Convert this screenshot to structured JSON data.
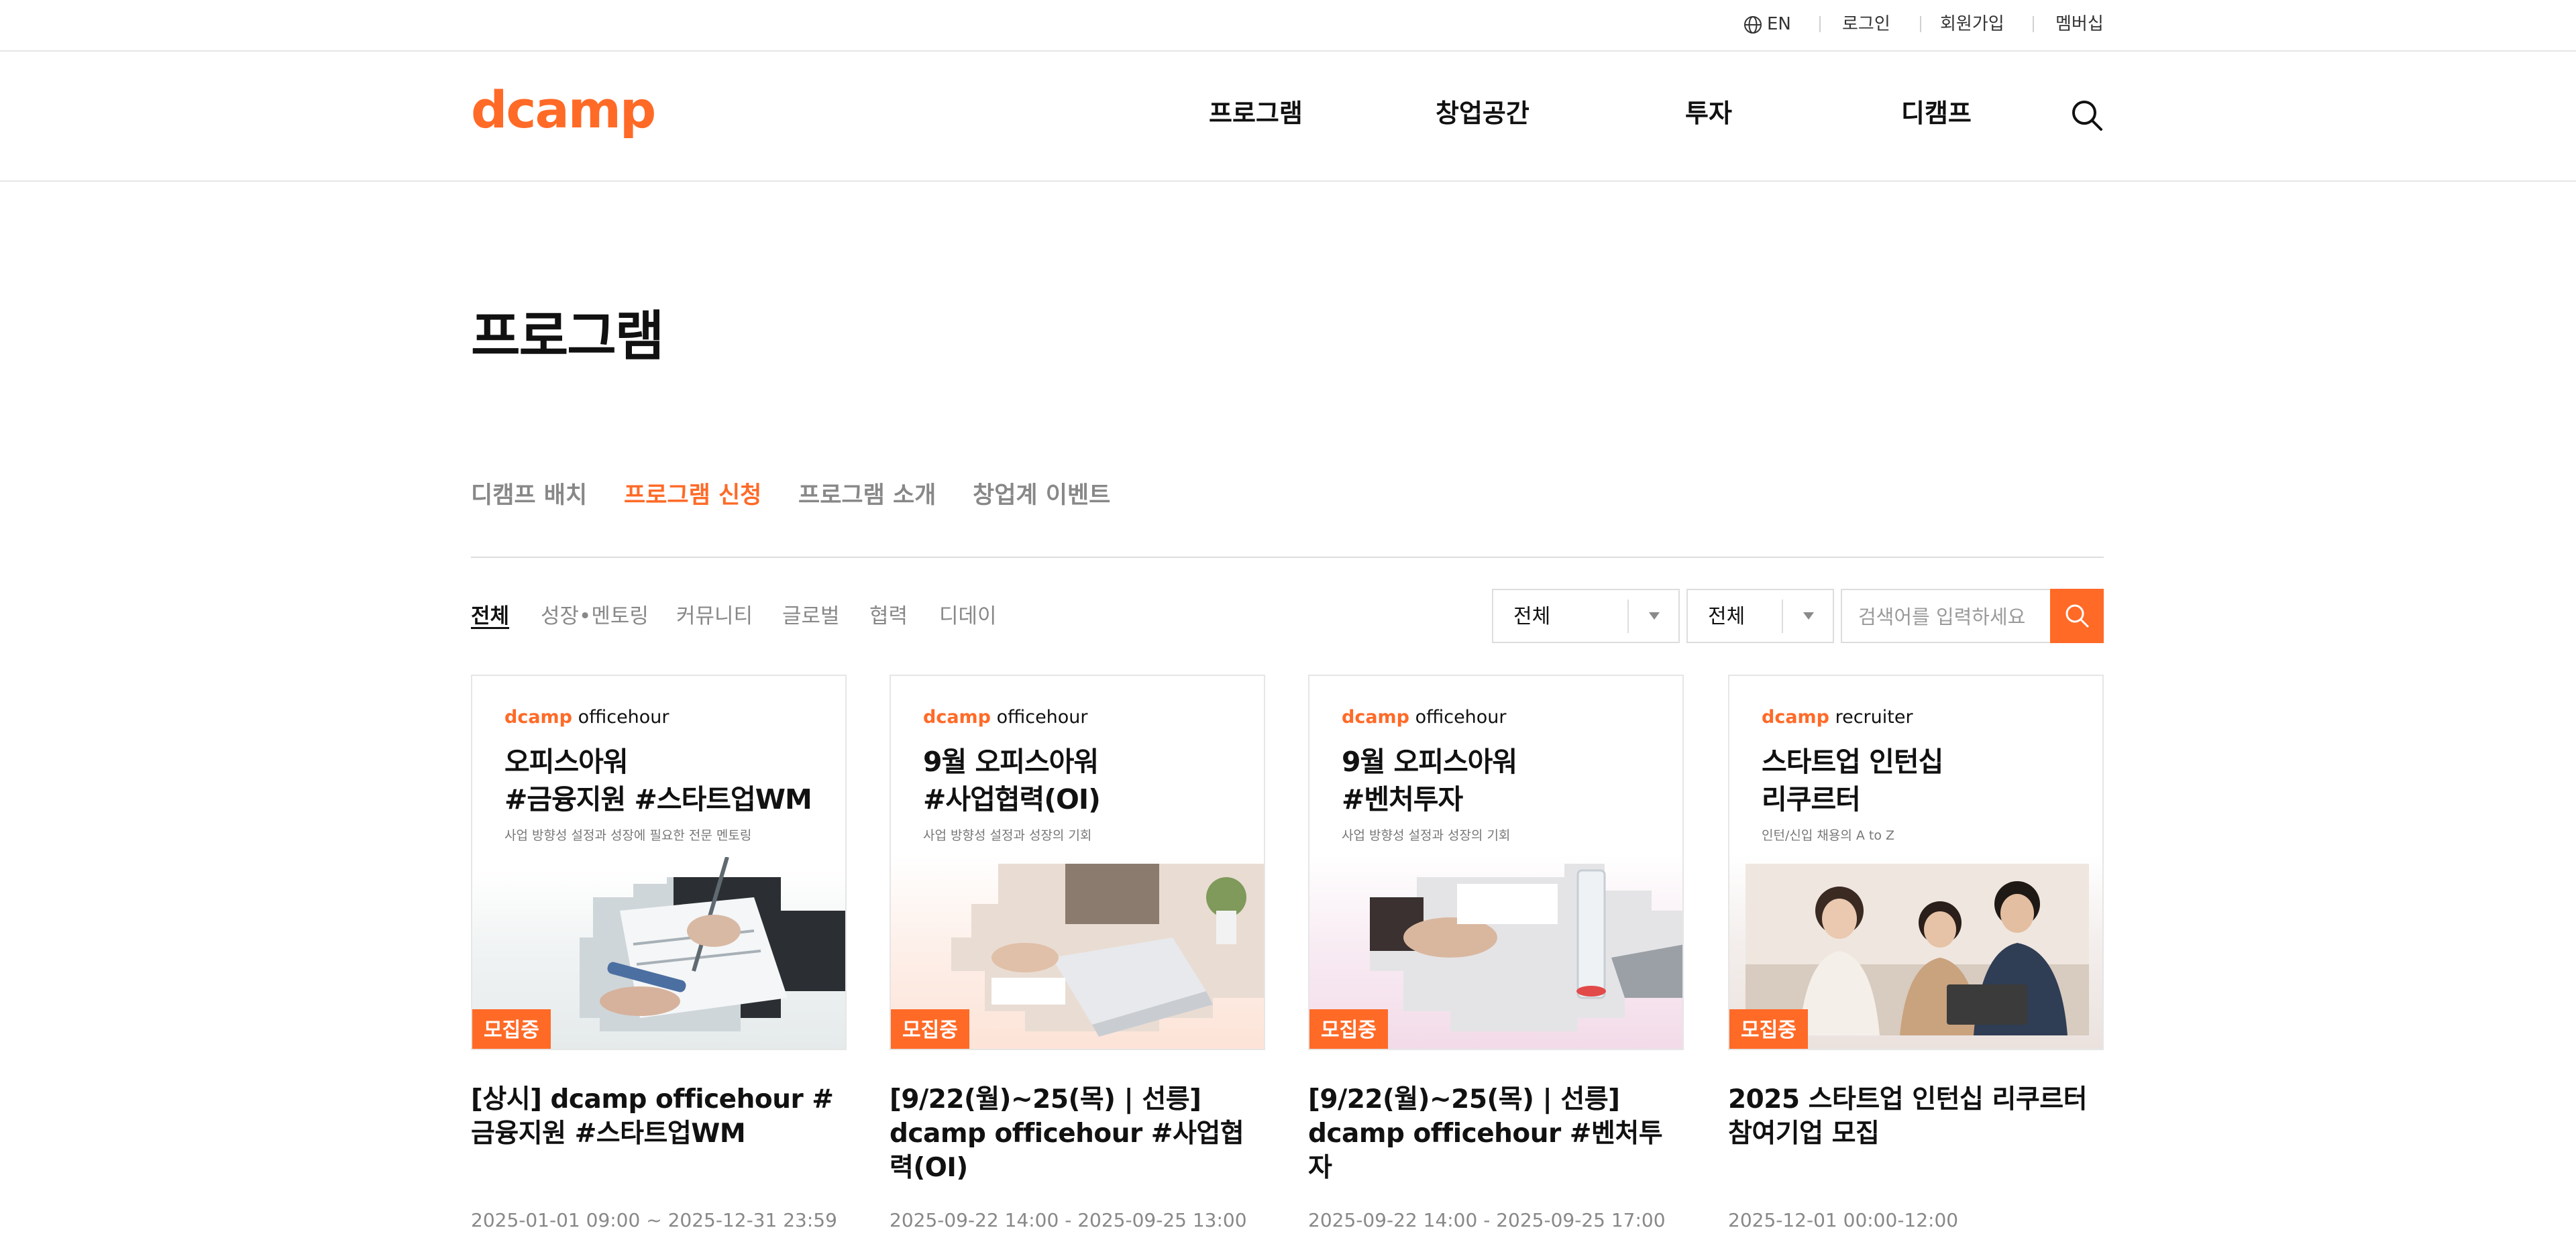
{
  "utilbar": {
    "lang": "EN",
    "login": "로그인",
    "signup": "회원가입",
    "membership": "멤버십"
  },
  "header": {
    "logo": "dcamp",
    "nav": [
      "프로그램",
      "창업공간",
      "투자",
      "디캠프"
    ]
  },
  "page": {
    "title": "프로그램"
  },
  "tabs": [
    "디캠프 배치",
    "프로그램 신청",
    "프로그램 소개",
    "창업계 이벤트"
  ],
  "categories": [
    "전체",
    "성장•멘토링",
    "커뮤니티",
    "글로벌",
    "협력",
    "디데이"
  ],
  "filters": {
    "select1": "전체",
    "select2": "전체",
    "search_placeholder": "검색어를 입력하세요"
  },
  "colors": {
    "accent": "#ff6a27",
    "text": "#111111",
    "muted": "#888888",
    "border": "#dddddd"
  },
  "cards": [
    {
      "brand_d": "dcamp",
      "brand_rest": " officehour",
      "thumb_title": "오피스아워\n#금융지원 #스타트업WM",
      "thumb_sub": "사업 방향성 설정과 성장에 필요한 전문 멘토링",
      "badge": "모집중",
      "title": "[상시] dcamp officehour #금융지원 #스타트업WM",
      "date": "2025-01-01 09:00 ~ 2025-12-31 23:59"
    },
    {
      "brand_d": "dcamp",
      "brand_rest": " officehour",
      "thumb_title": "9월 오피스아워\n#사업협력(OI)",
      "thumb_sub": "사업 방향성 설정과 성장의 기회",
      "badge": "모집중",
      "title": "[9/22(월)~25(목) | 선릉] dcamp officehour #사업협력(OI)",
      "date": "2025-09-22 14:00 - 2025-09-25 13:00"
    },
    {
      "brand_d": "dcamp",
      "brand_rest": " officehour",
      "thumb_title": "9월 오피스아워\n#벤처투자",
      "thumb_sub": "사업 방향성 설정과 성장의 기회",
      "badge": "모집중",
      "title": "[9/22(월)~25(목) | 선릉] dcamp officehour #벤처투자",
      "date": "2025-09-22 14:00 - 2025-09-25 17:00"
    },
    {
      "brand_d": "dcamp",
      "brand_rest": " recruiter",
      "thumb_title": "스타트업 인턴십\n리쿠르터",
      "thumb_sub": "인턴/신입 채용의 A to Z",
      "badge": "모집중",
      "title": "2025 스타트업 인턴십 리쿠르터 참여기업 모집",
      "date": "2025-12-01 00:00-12:00"
    }
  ]
}
